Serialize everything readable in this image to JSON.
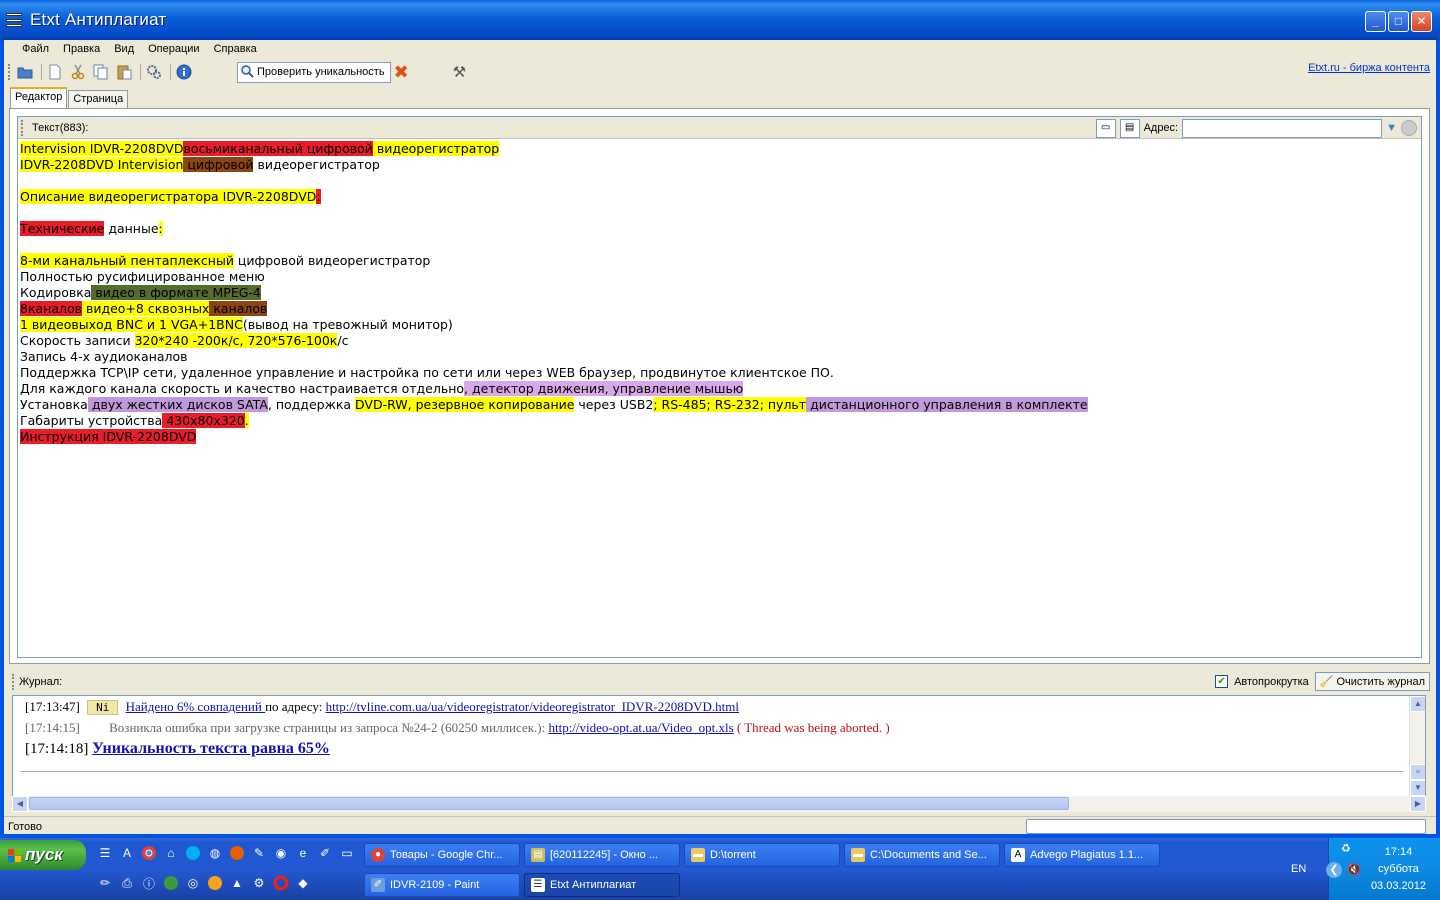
{
  "window": {
    "title": "Etxt Антиплагиат",
    "min": "_",
    "max": "□",
    "close": "✕"
  },
  "menu": [
    "Файл",
    "Правка",
    "Вид",
    "Операции",
    "Справка"
  ],
  "toolbar": {
    "check_label": "Проверить уникальность",
    "etxt_link": "Etxt.ru - биржа контента"
  },
  "tabs": [
    "Редактор",
    "Страница"
  ],
  "editor": {
    "header_label": "Текст(883):",
    "address_label": "Адрес:",
    "address_value": "",
    "lines": [
      [
        {
          "t": "Intervision IDVR-2208DVD",
          "c": "y"
        },
        {
          "t": "восьмиканальный цифровой",
          "c": "r"
        },
        {
          "t": " видеорегистратор",
          "c": "y"
        }
      ],
      [
        {
          "t": "IDVR-2208DVD Intervision",
          "c": "y"
        },
        {
          "t": " цифровой",
          "c": "b"
        },
        {
          "t": " видеорегистратор",
          "c": ""
        }
      ],
      [
        {
          "t": "",
          "c": ""
        }
      ],
      [
        {
          "t": "Описание видеорегистратора IDVR-2208DVD",
          "c": "y"
        },
        {
          "t": ":",
          "c": "r"
        }
      ],
      [
        {
          "t": "",
          "c": ""
        }
      ],
      [
        {
          "t": "Технические",
          "c": "r"
        },
        {
          "t": " данные",
          "c": ""
        },
        {
          "t": ":",
          "c": "y"
        }
      ],
      [
        {
          "t": "",
          "c": ""
        }
      ],
      [
        {
          "t": "8-ми канальный пентаплексный",
          "c": "y"
        },
        {
          "t": " цифровой видеорегистратор",
          "c": ""
        }
      ],
      [
        {
          "t": "Полностью русифицированное меню",
          "c": ""
        }
      ],
      [
        {
          "t": "Кодировка",
          "c": ""
        },
        {
          "t": " видео в формате MPEG-4",
          "c": "g"
        }
      ],
      [
        {
          "t": "8каналов",
          "c": "r"
        },
        {
          "t": " видео+8 сквозных",
          "c": "y"
        },
        {
          "t": " каналов",
          "c": "b"
        }
      ],
      [
        {
          "t": "1 видеовыход BNC и 1 VGA+1BNC",
          "c": "y"
        },
        {
          "t": "(вывод на тревожный монитор)",
          "c": ""
        }
      ],
      [
        {
          "t": "Скорость записи ",
          "c": ""
        },
        {
          "t": "320*240 -200к/с, 720*576-100к",
          "c": "y"
        },
        {
          "t": "/с",
          "c": ""
        }
      ],
      [
        {
          "t": "Запись 4-х аудиоканалов",
          "c": ""
        }
      ],
      [
        {
          "t": "Поддержка TCP\\IP сети, удаленное управление и настройка по сети или через WEB браузер, продвинутое клиентское ПО.",
          "c": ""
        }
      ],
      [
        {
          "t": "Для каждого канала скорость и качество настраивается отдельно",
          "c": ""
        },
        {
          "t": ", детектор движения, управление мышью",
          "c": "v"
        }
      ],
      [
        {
          "t": "Установка",
          "c": ""
        },
        {
          "t": " двух жестких дисков SATA",
          "c": "p"
        },
        {
          "t": ", поддержка ",
          "c": ""
        },
        {
          "t": "DVD-RW, резервное копирование",
          "c": "y"
        },
        {
          "t": " через USB2",
          "c": ""
        },
        {
          "t": "; RS-485; RS-232; пульт",
          "c": "y"
        },
        {
          "t": " дистанционного управления в комплекте",
          "c": "p"
        }
      ],
      [
        {
          "t": "Габариты устройства",
          "c": ""
        },
        {
          "t": " 430х80х320",
          "c": "r"
        },
        {
          "t": ".",
          "c": "y"
        }
      ],
      [
        {
          "t": "Инструкция IDVR-2208DVD",
          "c": "r"
        }
      ]
    ]
  },
  "journal": {
    "label": "Журнал:",
    "autoscroll": "Автопрокрутка",
    "clear": "Очистить журнал",
    "entry1": {
      "time": "[17:13:47]",
      "badge": "Ni",
      "found": "Найдено 6% совпадений ",
      "by": "по адресу: ",
      "url": "http://tvline.com.ua/ua/videoregistrator/videoregistrator_IDVR-2208DVD.html"
    },
    "entry2": {
      "time": "[17:14:15]",
      "msg": "Возникла ошибка при загрузке страницы из запроса №24-2 (60250 миллисек.): ",
      "url": "http://video-opt.at.ua/Video_opt.xls",
      "err": " ( Thread was being aborted. )"
    },
    "entry3": {
      "time": "[17:14:18]",
      "msg": "Уникальность текста равна 65%"
    }
  },
  "status": {
    "text": "Готово"
  },
  "taskbar": {
    "start": "пуск",
    "row1": [
      "Товары - Google Chr...",
      "[620112245] - Окно ...",
      "D:\\torrent",
      "C:\\Documents and Se...",
      "Advego Plagiatus 1.1..."
    ],
    "row2": [
      "IDVR-2109 - Paint",
      "Etxt Антиплагиат"
    ],
    "lang": "EN",
    "time": "17:14",
    "day": "суббота",
    "date": "03.03.2012"
  },
  "colors": {
    "yellow": "#FFFF00",
    "red": "#E81C2B",
    "olive": "#556B2F",
    "brown": "#8B4513",
    "purple": "#C09AD8",
    "titlebar": "#0A5FD8"
  }
}
